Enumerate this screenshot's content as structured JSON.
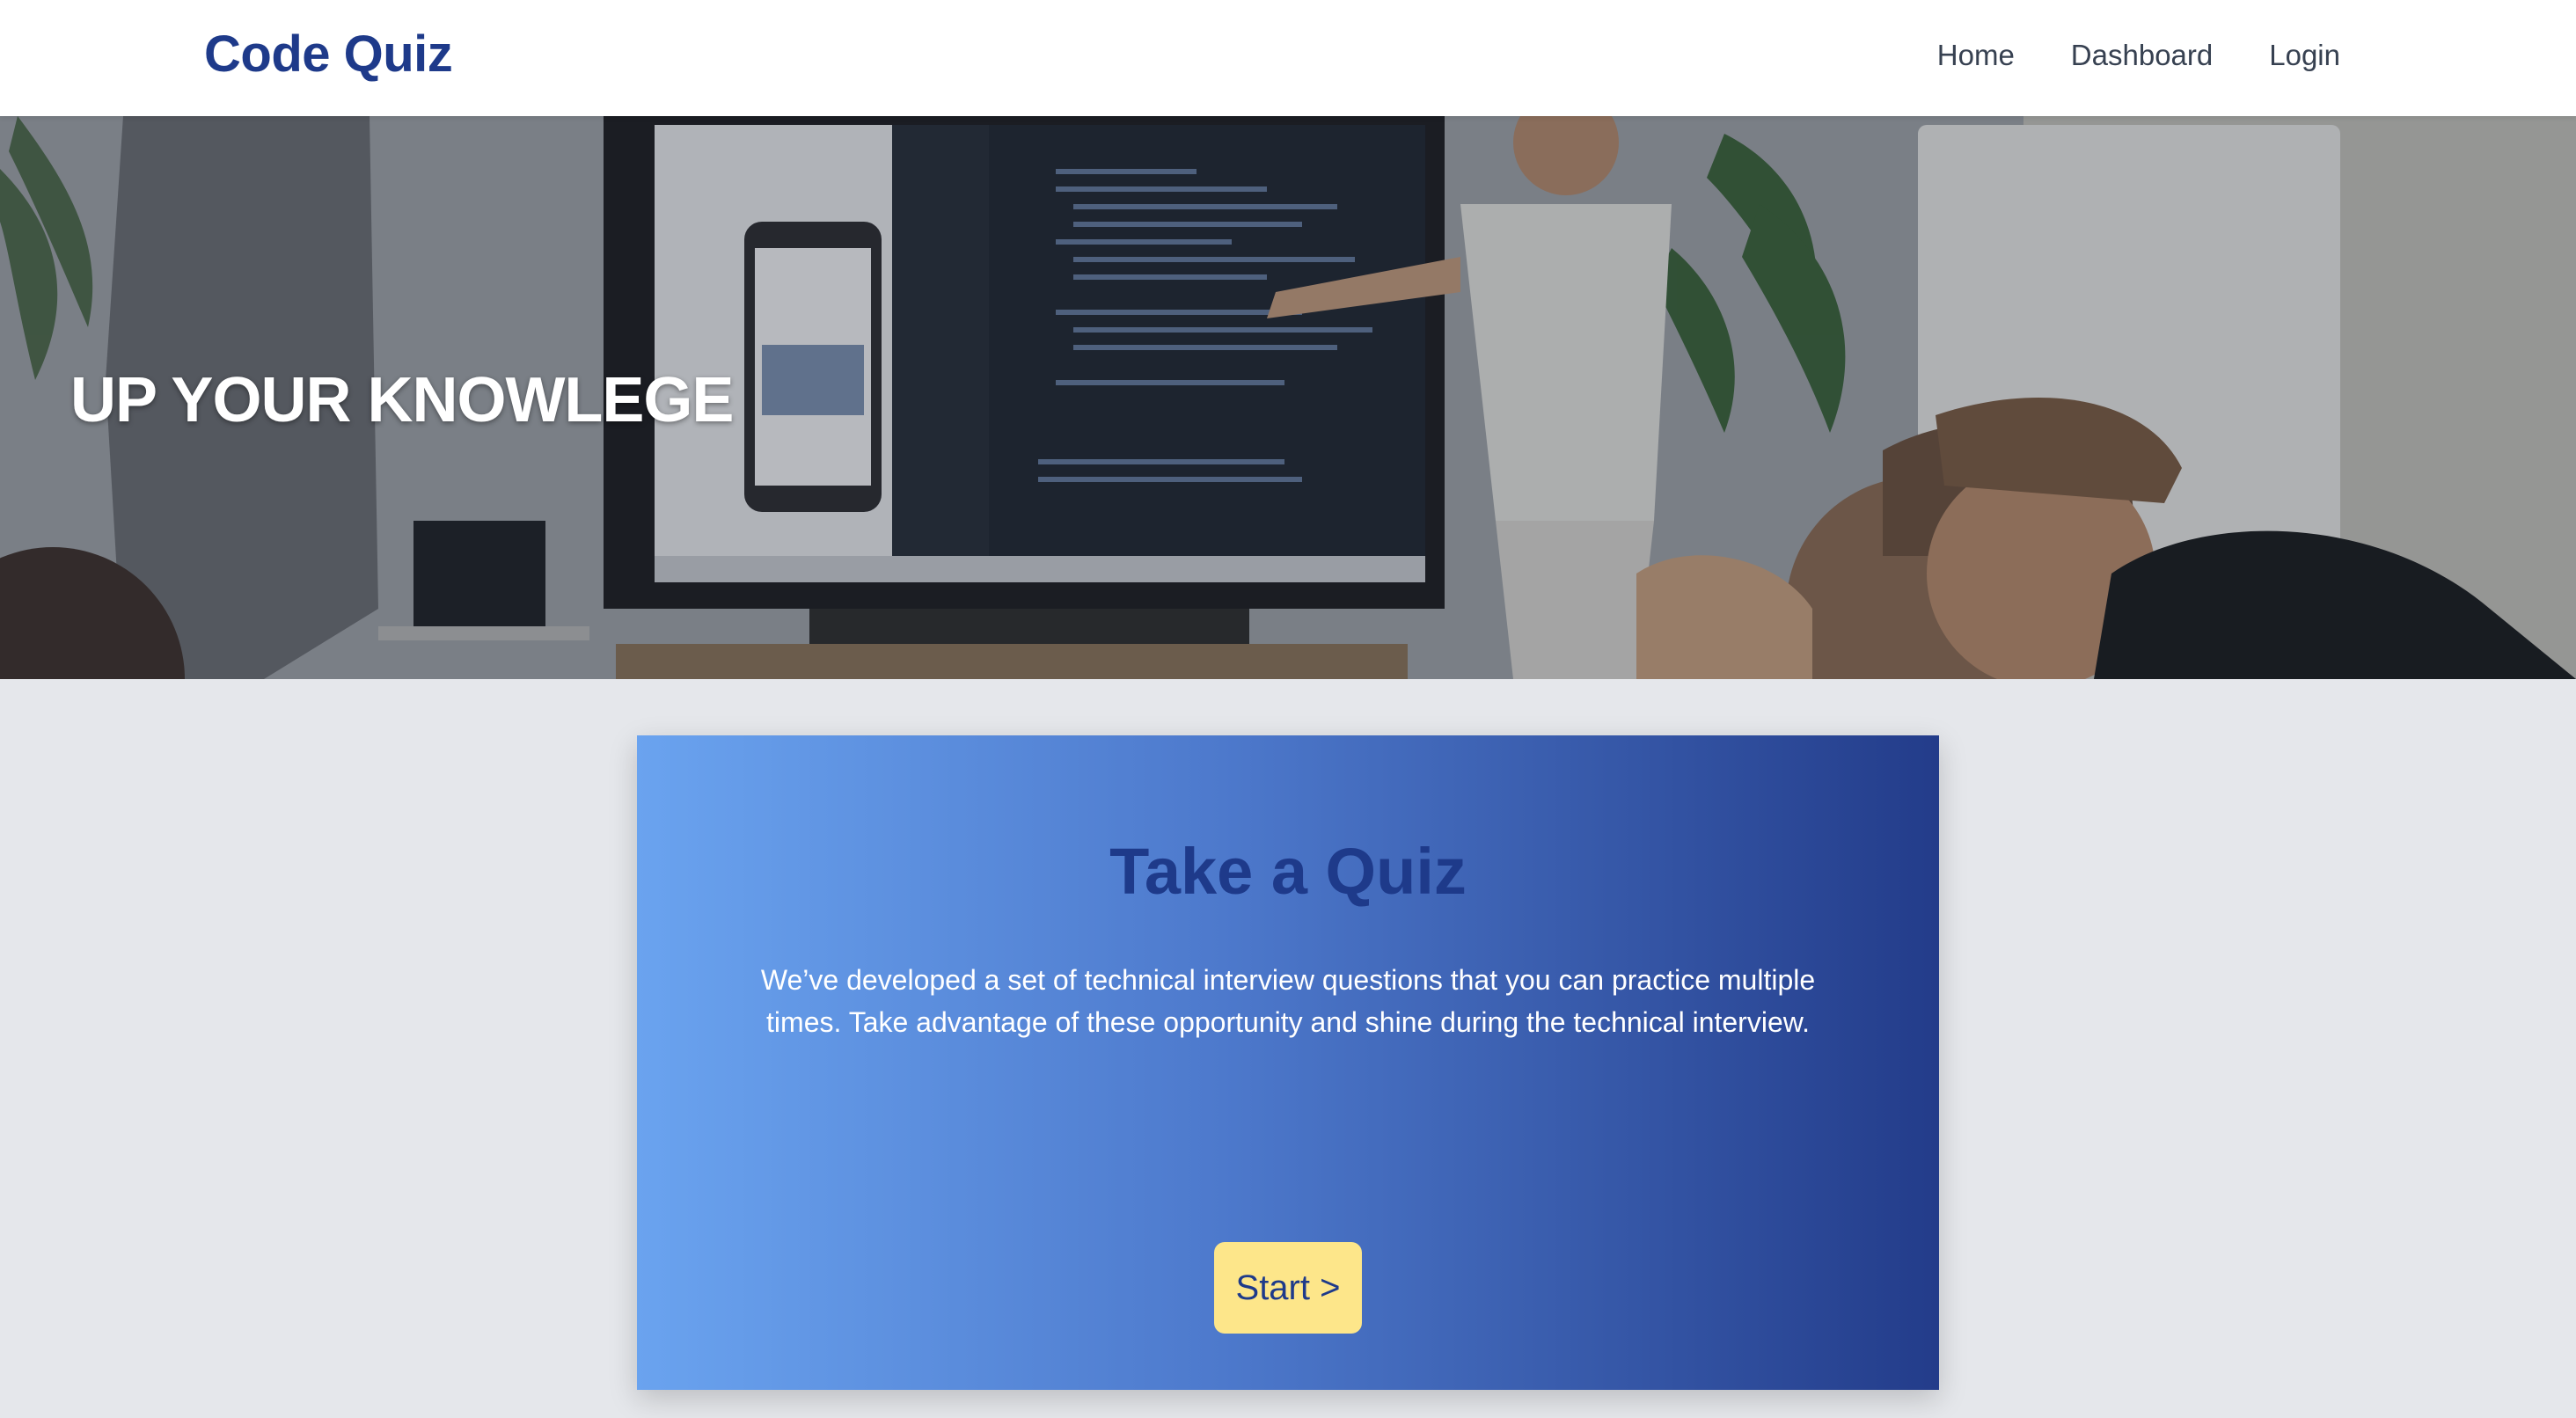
{
  "header": {
    "brand": "Code Quiz",
    "nav": [
      {
        "label": "Home"
      },
      {
        "label": "Dashboard"
      },
      {
        "label": "Login"
      }
    ]
  },
  "hero": {
    "title": "UP YOUR KNOWLEGE"
  },
  "quiz_card": {
    "title": "Take a Quiz",
    "description": "We’ve developed a set of technical interview questions that you can practice multiple times. Take advantage of these opportunity and shine during the technical interview.",
    "start_label": "Start >"
  },
  "colors": {
    "brand": "#1e3a8a",
    "card_gradient_start": "#6aa3ef",
    "card_gradient_end": "#233c8a",
    "button_bg": "#fde68a",
    "page_bg": "#e5e7eb"
  }
}
